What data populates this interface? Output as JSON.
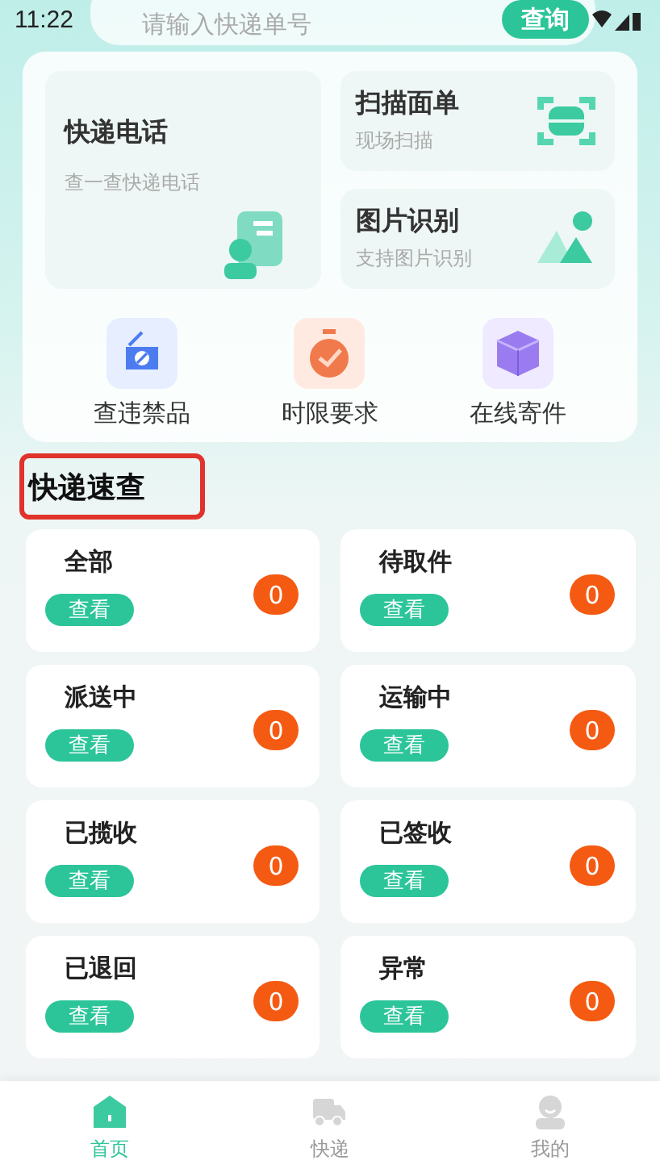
{
  "status_bar": {
    "time": "11:22"
  },
  "search": {
    "placeholder": "请输入快递单号",
    "button": "查询"
  },
  "feature_tiles": [
    {
      "kind": "phone",
      "title": "快递电话",
      "subtitle": "查一查快递电话"
    },
    {
      "kind": "scan",
      "title": "扫描面单",
      "subtitle": "现场扫描"
    },
    {
      "kind": "image",
      "title": "图片识别",
      "subtitle": "支持图片识别"
    }
  ],
  "shortcuts": [
    {
      "kind": "prohibited",
      "label": "查违禁品"
    },
    {
      "kind": "timer",
      "label": "时限要求"
    },
    {
      "kind": "parcel",
      "label": "在线寄件"
    }
  ],
  "section_title": "快递速查",
  "status_cards": [
    {
      "title": "全部",
      "button": "查看",
      "count": "0"
    },
    {
      "title": "待取件",
      "button": "查看",
      "count": "0"
    },
    {
      "title": "派送中",
      "button": "查看",
      "count": "0"
    },
    {
      "title": "运输中",
      "button": "查看",
      "count": "0"
    },
    {
      "title": "已揽收",
      "button": "查看",
      "count": "0"
    },
    {
      "title": "已签收",
      "button": "查看",
      "count": "0"
    },
    {
      "title": "已退回",
      "button": "查看",
      "count": "0"
    },
    {
      "title": "异常",
      "button": "查看",
      "count": "0"
    }
  ],
  "tab_bar": [
    {
      "kind": "home",
      "label": "首页",
      "selected": true
    },
    {
      "kind": "truck",
      "label": "快递",
      "selected": false
    },
    {
      "kind": "person",
      "label": "我的",
      "selected": false
    }
  ]
}
